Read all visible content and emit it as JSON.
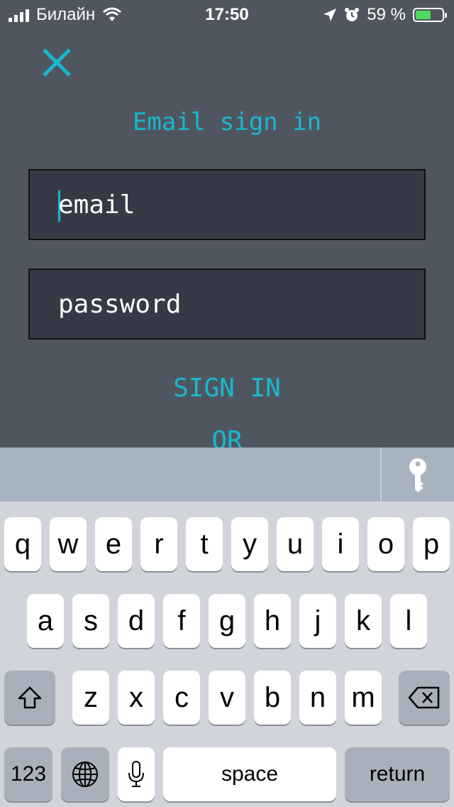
{
  "status_bar": {
    "carrier": "Билайн",
    "time": "17:50",
    "battery_percent": "59 %",
    "battery_level": 0.59,
    "icons": [
      "signal-icon",
      "wifi-icon",
      "location-arrow-icon",
      "alarm-icon",
      "battery-icon"
    ]
  },
  "form": {
    "title": "Email sign in",
    "email_placeholder": "email",
    "password_placeholder": "password",
    "signin_label": "SIGN IN",
    "or_label": "OR"
  },
  "keyboard": {
    "row1": [
      "q",
      "w",
      "e",
      "r",
      "t",
      "y",
      "u",
      "i",
      "o",
      "p"
    ],
    "row2": [
      "a",
      "s",
      "d",
      "f",
      "g",
      "h",
      "j",
      "k",
      "l"
    ],
    "row3": [
      "z",
      "x",
      "c",
      "v",
      "b",
      "n",
      "m"
    ],
    "numbers_label": "123",
    "space_label": "space",
    "return_label": "return"
  },
  "colors": {
    "accent": "#17b8d0",
    "background": "#505660",
    "field_background": "#373a46",
    "keyboard_background": "#d1d5db"
  }
}
